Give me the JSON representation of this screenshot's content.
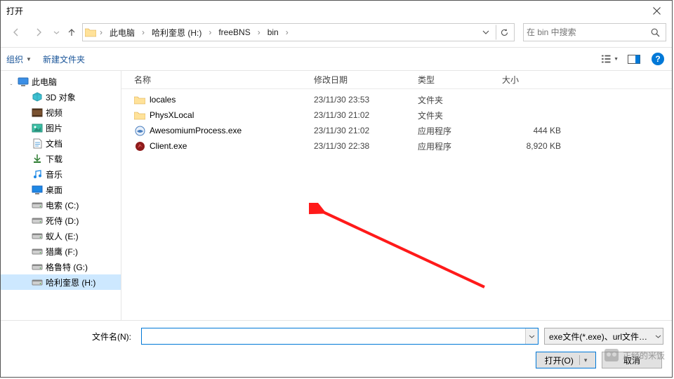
{
  "window": {
    "title": "打开"
  },
  "nav": {
    "crumbs": [
      "此电脑",
      "哈利奎恩 (H:)",
      "freeBNS",
      "bin"
    ],
    "search_placeholder": "在 bin 中搜索"
  },
  "toolbar": {
    "organize": "组织",
    "newfolder": "新建文件夹"
  },
  "sidebar": {
    "root": "此电脑",
    "items": [
      {
        "label": "3D 对象",
        "icon": "3d"
      },
      {
        "label": "视频",
        "icon": "video"
      },
      {
        "label": "图片",
        "icon": "picture"
      },
      {
        "label": "文档",
        "icon": "doc"
      },
      {
        "label": "下载",
        "icon": "download"
      },
      {
        "label": "音乐",
        "icon": "music"
      },
      {
        "label": "桌面",
        "icon": "desktop"
      },
      {
        "label": "电索 (C:)",
        "icon": "drive"
      },
      {
        "label": "死侍 (D:)",
        "icon": "drive"
      },
      {
        "label": "蚁人 (E:)",
        "icon": "drive"
      },
      {
        "label": "猎鹰 (F:)",
        "icon": "drive"
      },
      {
        "label": "格鲁特 (G:)",
        "icon": "drive"
      },
      {
        "label": "哈利奎恩 (H:)",
        "icon": "drive",
        "selected": true
      }
    ]
  },
  "columns": {
    "name": "名称",
    "date": "修改日期",
    "type": "类型",
    "size": "大小"
  },
  "files": [
    {
      "name": "locales",
      "date": "23/11/30 23:53",
      "type": "文件夹",
      "size": "",
      "icon": "folder"
    },
    {
      "name": "PhysXLocal",
      "date": "23/11/30 21:02",
      "type": "文件夹",
      "size": "",
      "icon": "folder"
    },
    {
      "name": "AwesomiumProcess.exe",
      "date": "23/11/30 21:02",
      "type": "应用程序",
      "size": "444 KB",
      "icon": "exe-blue"
    },
    {
      "name": "Client.exe",
      "date": "23/11/30 22:38",
      "type": "应用程序",
      "size": "8,920 KB",
      "icon": "exe-red"
    }
  ],
  "bottom": {
    "filename_label": "文件名(N):",
    "filter": "exe文件(*.exe)、url文件、快捷",
    "open": "打开(O)",
    "cancel": "取消"
  },
  "watermark": "正经的米饭"
}
